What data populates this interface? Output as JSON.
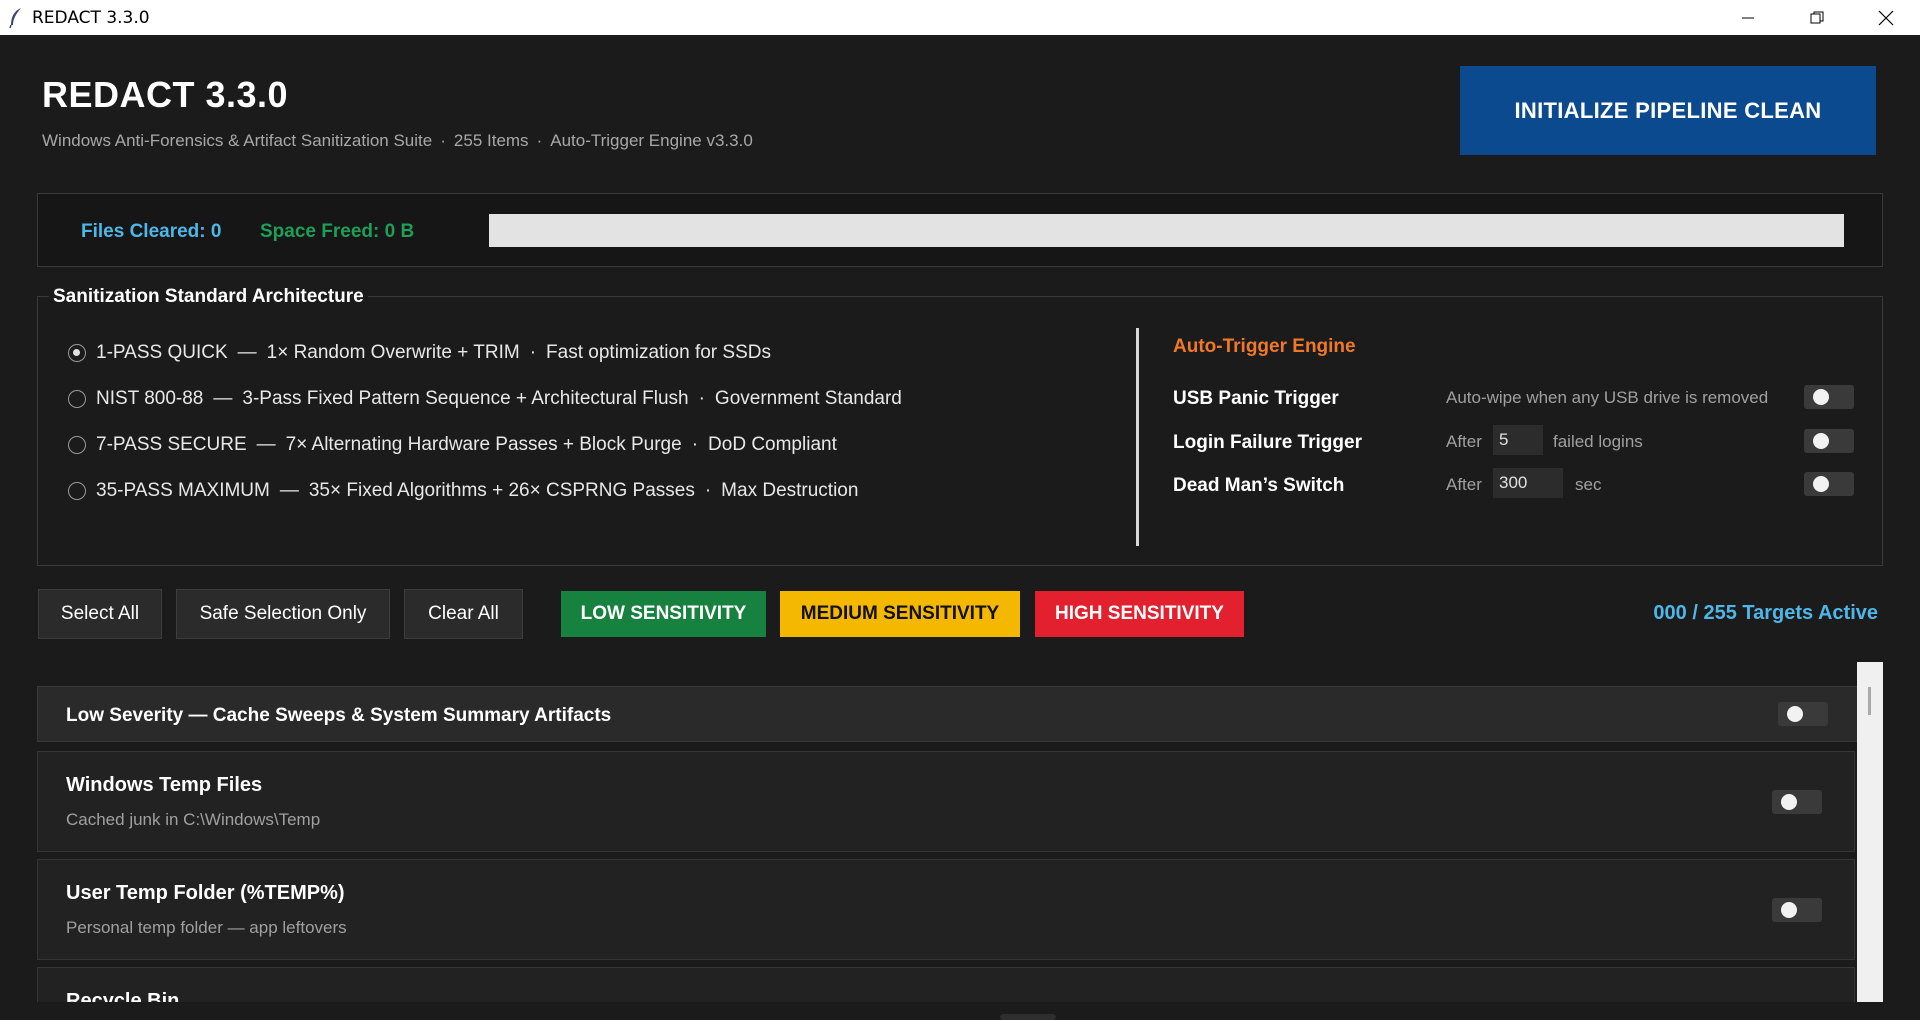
{
  "window": {
    "title": "REDACT 3.3.0"
  },
  "header": {
    "title": "REDACT 3.3.0",
    "subtitle_parts": [
      "Windows Anti-Forensics & Artifact Sanitization Suite",
      "255 Items",
      "Auto-Trigger Engine v3.3.0"
    ],
    "separator": "·",
    "init_button": "INITIALIZE PIPELINE CLEAN"
  },
  "stats": {
    "files_cleared": "Files Cleared: 0",
    "space_freed": "Space Freed: 0 B",
    "progress": 0
  },
  "architecture": {
    "legend": "Sanitization Standard Architecture",
    "options": [
      {
        "name": "1-PASS QUICK",
        "dash": "—",
        "detail": "1× Random Overwrite + TRIM",
        "dot": "·",
        "note": "Fast optimization for SSDs",
        "selected": true
      },
      {
        "name": "NIST 800-88",
        "dash": "—",
        "detail": "3-Pass Fixed Pattern Sequence + Architectural Flush",
        "dot": "·",
        "note": "Government Standard",
        "selected": false
      },
      {
        "name": "7-PASS SECURE",
        "dash": "—",
        "detail": "7× Alternating Hardware Passes + Block Purge",
        "dot": "·",
        "note": "DoD Compliant",
        "selected": false
      },
      {
        "name": "35-PASS MAXIMUM",
        "dash": "—",
        "detail": "35× Fixed Algorithms + 26× CSPRNG Passes",
        "dot": "·",
        "note": "Max Destruction",
        "selected": false
      }
    ]
  },
  "auto_trigger": {
    "title": "Auto-Trigger Engine",
    "usb": {
      "label": "USB Panic Trigger",
      "desc": "Auto-wipe when any USB drive is removed",
      "enabled": false
    },
    "login": {
      "label": "Login Failure Trigger",
      "prefix": "After",
      "value": "5",
      "unit": "failed logins",
      "enabled": false
    },
    "deadman": {
      "label": "Dead Man’s Switch",
      "prefix": "After",
      "value": "300",
      "unit": "sec",
      "enabled": false
    }
  },
  "actions": {
    "select_all": "Select All",
    "safe_selection": "Safe Selection Only",
    "clear_all": "Clear All",
    "low": "LOW SENSITIVITY",
    "medium": "MEDIUM SENSITIVITY",
    "high": "HIGH SENSITIVITY",
    "targets_active": "000 / 255 Targets Active"
  },
  "colors": {
    "low": "#17813f",
    "medium": "#f5b800",
    "high": "#e2202e",
    "accent_blue": "#4fb6e8",
    "accent_orange": "#f07828"
  },
  "list": {
    "group": {
      "title": "Low Severity — Cache Sweeps & System Summary Artifacts",
      "enabled": false
    },
    "items": [
      {
        "name": "Windows Temp Files",
        "desc": "Cached junk in C:\\Windows\\Temp",
        "enabled": false
      },
      {
        "name": "User Temp Folder (%TEMP%)",
        "desc": "Personal temp folder — app leftovers",
        "enabled": false
      },
      {
        "name": "Recycle Bin",
        "desc": "",
        "enabled": false
      }
    ]
  }
}
